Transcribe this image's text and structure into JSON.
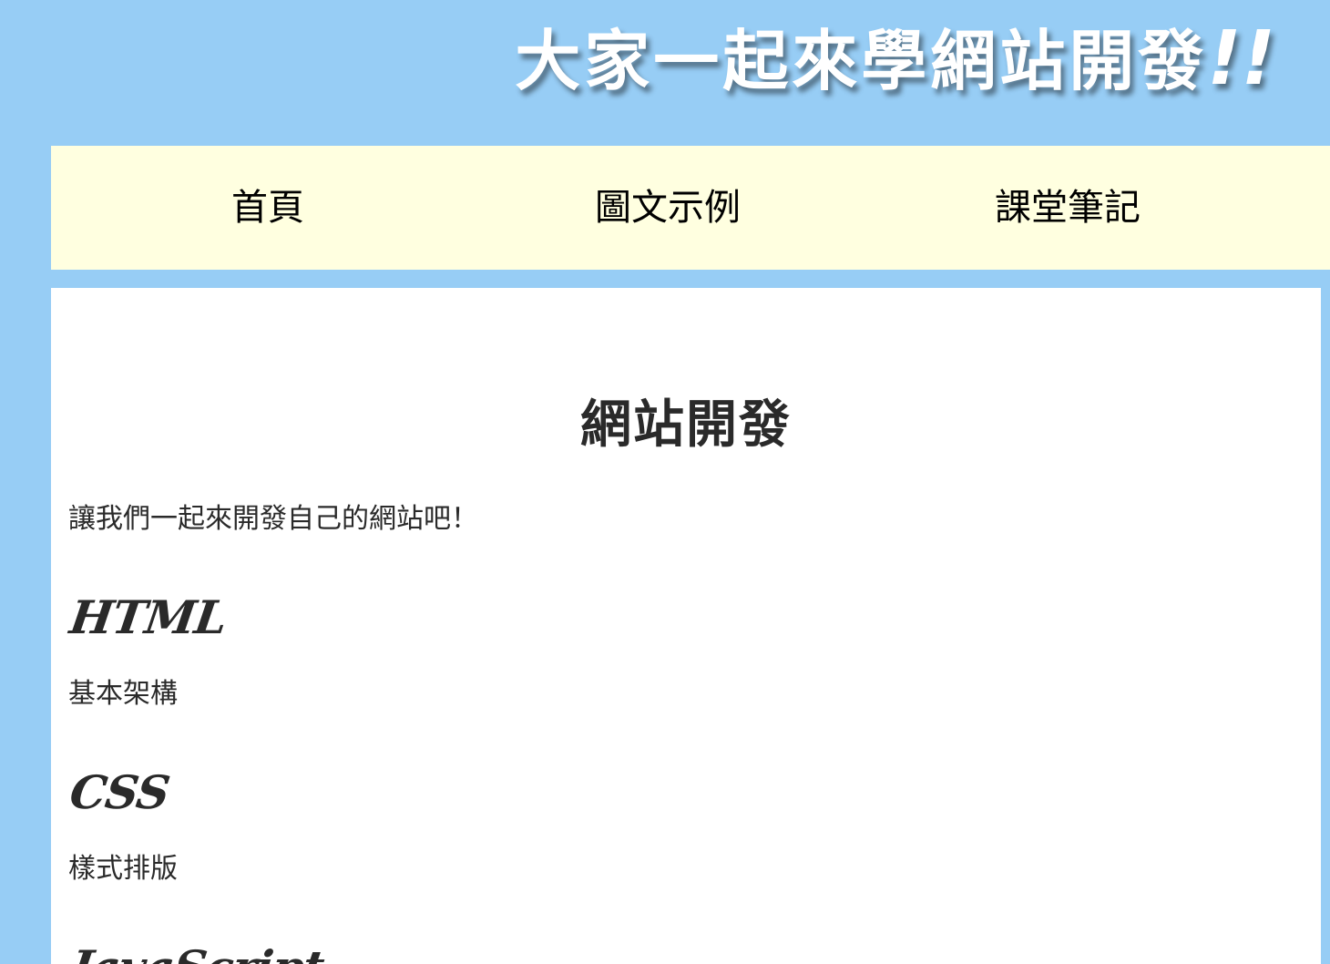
{
  "header": {
    "title": "大家一起來學網站開發",
    "title_suffix": "!!"
  },
  "nav": {
    "items": [
      {
        "label": "首頁"
      },
      {
        "label": "圖文示例"
      },
      {
        "label": "課堂筆記"
      }
    ]
  },
  "main": {
    "title": "網站開發",
    "intro": "讓我們一起來開發自己的網站吧！",
    "sections": [
      {
        "heading": "HTML",
        "description": "基本架構"
      },
      {
        "heading": "CSS",
        "description": "樣式排版"
      },
      {
        "heading": "JavaScript",
        "description": ""
      }
    ]
  },
  "colors": {
    "page_background": "#97cdf5",
    "nav_background": "#ffffe0",
    "content_background": "#ffffff",
    "title_text": "#ffffff",
    "body_text": "#2a2a2a"
  }
}
